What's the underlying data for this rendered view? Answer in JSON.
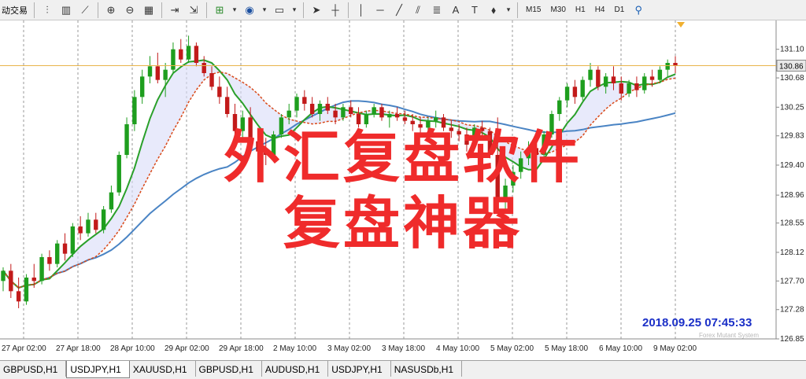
{
  "toolbar": {
    "left_label": "动交易",
    "timeframes": [
      "M15",
      "M30",
      "H1",
      "H4",
      "D1"
    ]
  },
  "chart_data": {
    "type": "candlestick",
    "symbol": "USDJPY,H1",
    "ylim": [
      126.85,
      131.5
    ],
    "y_ticks": [
      "131.10",
      "130.68",
      "130.25",
      "129.83",
      "129.40",
      "128.96",
      "128.55",
      "128.12",
      "127.70",
      "127.28",
      "126.85"
    ],
    "current_price_label": "130.86",
    "current_price": 130.86,
    "x_ticks": [
      "27 Apr 02:00",
      "27 Apr 18:00",
      "28 Apr 10:00",
      "29 Apr 02:00",
      "29 Apr 18:00",
      "2 May 10:00",
      "3 May 02:00",
      "3 May 18:00",
      "4 May 10:00",
      "5 May 02:00",
      "5 May 18:00",
      "6 May 10:00",
      "9 May 02:00"
    ],
    "ohlc": [
      [
        127.7,
        127.9,
        127.55,
        127.85
      ],
      [
        127.85,
        127.95,
        127.45,
        127.55
      ],
      [
        127.55,
        127.75,
        127.3,
        127.4
      ],
      [
        127.4,
        127.8,
        127.35,
        127.75
      ],
      [
        127.75,
        127.95,
        127.6,
        127.7
      ],
      [
        127.7,
        128.1,
        127.65,
        128.05
      ],
      [
        128.05,
        128.15,
        127.85,
        127.95
      ],
      [
        127.95,
        128.3,
        127.9,
        128.25
      ],
      [
        128.25,
        128.4,
        128.0,
        128.1
      ],
      [
        128.1,
        128.55,
        128.05,
        128.5
      ],
      [
        128.5,
        128.65,
        128.3,
        128.4
      ],
      [
        128.4,
        128.7,
        128.35,
        128.6
      ],
      [
        128.6,
        128.7,
        128.4,
        128.45
      ],
      [
        128.45,
        128.8,
        128.4,
        128.75
      ],
      [
        128.75,
        129.1,
        128.7,
        129.0
      ],
      [
        129.0,
        129.6,
        128.95,
        129.55
      ],
      [
        129.55,
        130.1,
        129.5,
        130.0
      ],
      [
        130.0,
        130.5,
        129.9,
        130.4
      ],
      [
        130.4,
        130.8,
        130.3,
        130.7
      ],
      [
        130.7,
        131.0,
        130.6,
        130.85
      ],
      [
        130.85,
        131.05,
        130.6,
        130.65
      ],
      [
        130.65,
        130.9,
        130.4,
        130.8
      ],
      [
        130.8,
        131.2,
        130.75,
        131.1
      ],
      [
        131.1,
        131.25,
        130.9,
        130.95
      ],
      [
        130.95,
        131.3,
        130.9,
        131.15
      ],
      [
        131.15,
        131.2,
        130.85,
        130.9
      ],
      [
        130.9,
        131.0,
        130.7,
        130.75
      ],
      [
        130.75,
        130.85,
        130.5,
        130.55
      ],
      [
        130.55,
        130.7,
        130.3,
        130.4
      ],
      [
        130.4,
        130.55,
        130.1,
        130.15
      ],
      [
        130.15,
        130.3,
        129.85,
        129.9
      ],
      [
        129.9,
        130.2,
        129.8,
        130.1
      ],
      [
        130.1,
        130.25,
        129.7,
        129.75
      ],
      [
        129.75,
        129.95,
        129.5,
        129.6
      ],
      [
        129.6,
        129.8,
        129.4,
        129.55
      ],
      [
        129.55,
        129.9,
        129.45,
        129.85
      ],
      [
        129.85,
        130.15,
        129.8,
        130.1
      ],
      [
        130.1,
        130.3,
        130.0,
        130.2
      ],
      [
        130.2,
        130.45,
        130.1,
        130.4
      ],
      [
        130.4,
        130.5,
        130.2,
        130.3
      ],
      [
        130.3,
        130.4,
        130.1,
        130.15
      ],
      [
        130.15,
        130.35,
        130.05,
        130.3
      ],
      [
        130.3,
        130.4,
        130.15,
        130.2
      ],
      [
        130.2,
        130.3,
        130.0,
        130.1
      ],
      [
        130.1,
        130.3,
        130.05,
        130.25
      ],
      [
        130.25,
        130.35,
        130.1,
        130.15
      ],
      [
        130.15,
        130.25,
        129.95,
        130.0
      ],
      [
        130.0,
        130.2,
        129.95,
        130.15
      ],
      [
        130.15,
        130.3,
        130.1,
        130.25
      ],
      [
        130.25,
        130.3,
        130.05,
        130.1
      ],
      [
        130.1,
        130.2,
        129.95,
        130.15
      ],
      [
        130.15,
        130.25,
        130.05,
        130.1
      ],
      [
        130.1,
        130.2,
        130.0,
        130.05
      ],
      [
        130.05,
        130.15,
        129.9,
        130.0
      ],
      [
        130.0,
        130.1,
        129.85,
        129.95
      ],
      [
        129.95,
        130.1,
        129.9,
        130.05
      ],
      [
        130.05,
        130.2,
        129.95,
        130.1
      ],
      [
        130.1,
        130.15,
        129.9,
        129.95
      ],
      [
        129.95,
        130.05,
        129.8,
        129.9
      ],
      [
        129.9,
        130.0,
        129.75,
        129.85
      ],
      [
        129.85,
        129.95,
        129.6,
        129.7
      ],
      [
        129.7,
        130.0,
        129.65,
        129.95
      ],
      [
        129.95,
        130.05,
        129.8,
        129.9
      ],
      [
        129.9,
        129.95,
        129.5,
        129.55
      ],
      [
        129.55,
        130.1,
        128.8,
        128.9
      ],
      [
        128.9,
        129.2,
        128.75,
        129.1
      ],
      [
        129.1,
        129.4,
        129.0,
        129.3
      ],
      [
        129.3,
        129.6,
        129.2,
        129.5
      ],
      [
        129.5,
        129.75,
        129.4,
        129.65
      ],
      [
        129.65,
        129.8,
        129.45,
        129.55
      ],
      [
        129.55,
        129.9,
        129.5,
        129.85
      ],
      [
        129.85,
        130.2,
        129.8,
        130.15
      ],
      [
        130.15,
        130.4,
        130.05,
        130.35
      ],
      [
        130.35,
        130.6,
        130.25,
        130.55
      ],
      [
        130.55,
        130.65,
        130.3,
        130.4
      ],
      [
        130.4,
        130.7,
        130.35,
        130.65
      ],
      [
        130.65,
        130.9,
        130.55,
        130.8
      ],
      [
        130.8,
        130.85,
        130.5,
        130.55
      ],
      [
        130.55,
        130.75,
        130.45,
        130.7
      ],
      [
        130.7,
        130.85,
        130.5,
        130.6
      ],
      [
        130.6,
        130.7,
        130.35,
        130.45
      ],
      [
        130.45,
        130.65,
        130.4,
        130.6
      ],
      [
        130.6,
        130.7,
        130.4,
        130.5
      ],
      [
        130.5,
        130.75,
        130.45,
        130.7
      ],
      [
        130.7,
        130.8,
        130.55,
        130.65
      ],
      [
        130.65,
        130.85,
        130.6,
        130.8
      ],
      [
        130.8,
        130.95,
        130.7,
        130.9
      ],
      [
        130.9,
        131.0,
        130.75,
        130.86
      ]
    ],
    "bull_color": "#1e9e1e",
    "bear_color": "#c21a1a",
    "ma_blue_color": "#4a84c4",
    "ma_green_color": "#2aa02a",
    "ma_red_color": "#d94a1a",
    "grid": "vertical-dashed",
    "current_price_line_color": "#e8b44a"
  },
  "overlay": {
    "line1": "外汇复盘软件",
    "line2": "复盘神器"
  },
  "timestamp": "2018.09.25 07:45:33",
  "watermark": "Forex Mutant System",
  "tabs": [
    {
      "label": "GBPUSD,H1",
      "active": false
    },
    {
      "label": "USDJPY,H1",
      "active": true
    },
    {
      "label": "XAUUSD,H1",
      "active": false
    },
    {
      "label": "GBPUSD,H1",
      "active": false
    },
    {
      "label": "AUDUSD,H1",
      "active": false
    },
    {
      "label": "USDJPY,H1",
      "active": false
    },
    {
      "label": "NASUSDb,H1",
      "active": false
    }
  ]
}
